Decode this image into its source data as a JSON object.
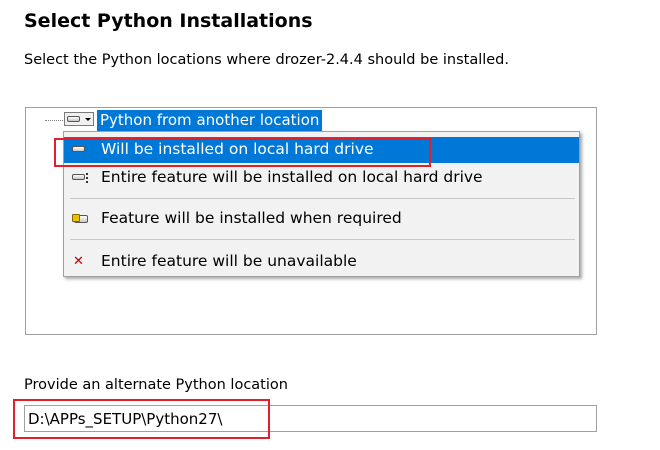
{
  "header": {
    "title": "Select Python Installations",
    "subtitle": "Select the Python locations where drozer-2.4.4 should be installed."
  },
  "tree": {
    "item_label": "Python from another location",
    "item_icon": "drive-dropdown-icon"
  },
  "menu": {
    "items": [
      {
        "label": "Will be installed on local hard drive",
        "icon": "drive-icon",
        "selected": true
      },
      {
        "label": "Entire feature will be installed on local hard drive",
        "icon": "drive-multi-icon",
        "selected": false
      },
      {
        "label": "Feature will be installed when required",
        "icon": "install-on-demand-icon",
        "selected": false
      },
      {
        "label": "Entire feature will be unavailable",
        "icon": "unavailable-x-icon",
        "selected": false
      }
    ]
  },
  "alternate": {
    "label": "Provide an alternate Python location",
    "value": "D:\\APPs_SETUP\\Python27\\"
  },
  "colors": {
    "selection": "#0078d7",
    "highlight_box": "#e0202c",
    "unavailable_x": "#c00000"
  }
}
